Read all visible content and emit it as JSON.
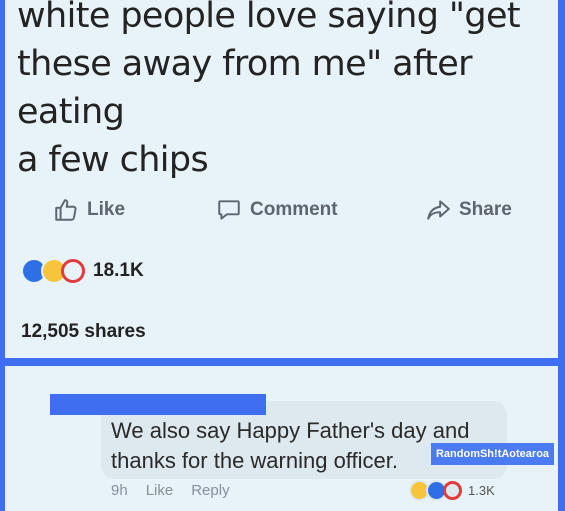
{
  "post": {
    "text_lines": [
      "white people love saying \"get",
      "these away from me\" after eating",
      "a few chips"
    ],
    "actions": {
      "like": {
        "label": "Like",
        "icon": "thumbs-up-icon"
      },
      "comment": {
        "label": "Comment",
        "icon": "speech-bubble-icon"
      },
      "share": {
        "label": "Share",
        "icon": "share-arrow-icon"
      }
    },
    "reactions": {
      "icons": [
        "like-icon",
        "haha-icon",
        "love-icon"
      ],
      "count": "18.1K"
    },
    "shares": "12,505 shares"
  },
  "comment": {
    "text_lines": [
      "We also say Happy Father's day and",
      "thanks for the warning officer."
    ],
    "time": "9h",
    "like_label": "Like",
    "reply_label": "Reply",
    "reactions": {
      "icons": [
        "haha-icon",
        "like-icon",
        "love-icon"
      ],
      "count": "1.3K"
    }
  },
  "watermark": "RandomSh!tAotearoa",
  "colors": {
    "border": "#3f6ff0",
    "panel": "#e7f3f8",
    "love": "#e23b3b",
    "like": "#2f6fe6",
    "haha": "#f6c53b"
  }
}
